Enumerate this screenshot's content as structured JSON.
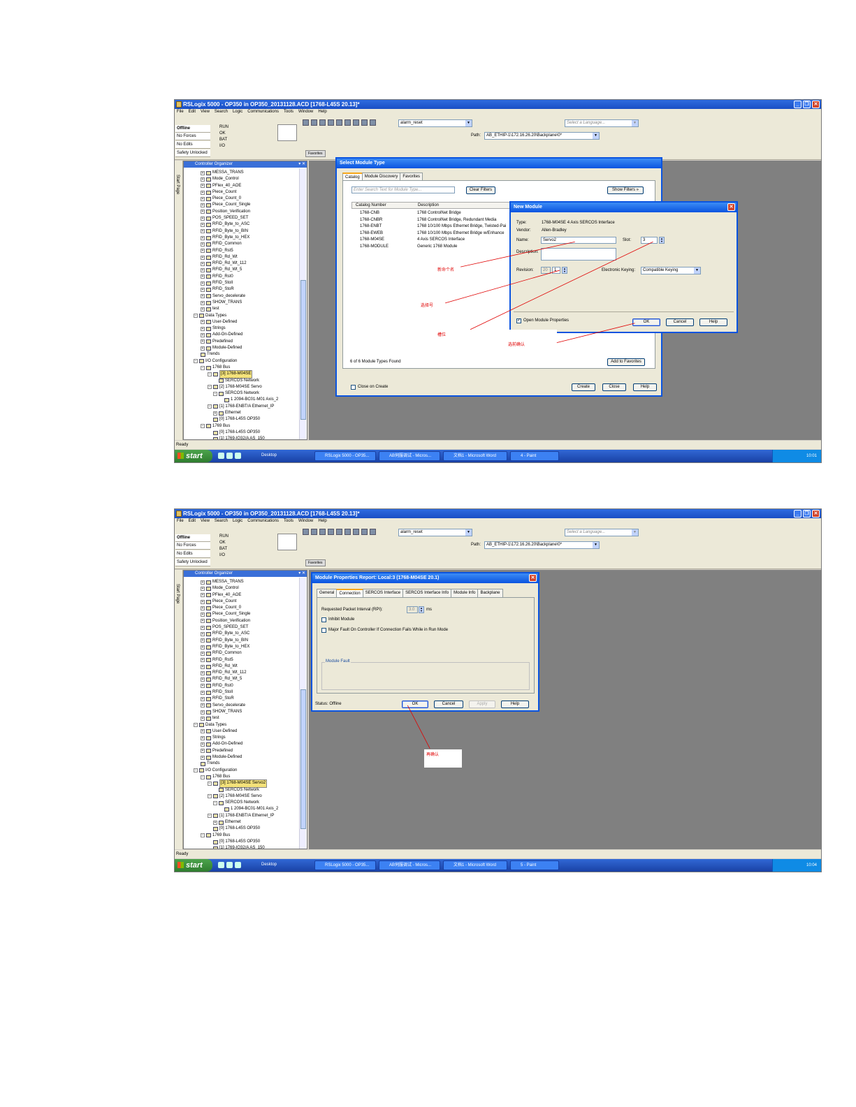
{
  "app": {
    "title": "RSLogix 5000 - OP350 in OP350_20131128.ACD [1768-L45S 20.13]*",
    "menu": [
      "File",
      "Edit",
      "View",
      "Search",
      "Logic",
      "Communications",
      "Tools",
      "Window",
      "Help"
    ],
    "status": {
      "offline": "Offline",
      "forces": "No Forces",
      "edits": "No Edits",
      "safety": "Safety Unlocked"
    },
    "indicators": [
      "RUN",
      "OK",
      "BAT",
      "I/O"
    ],
    "routine_combo": "alarm_reset",
    "language_combo_placeholder": "Select a Language...",
    "path_label": "Path:",
    "path_value": "AB_ETHIP-1\\172.16.26.20\\Backplane\\0*",
    "toolbar_tab": "Favorites",
    "organizer_title": "Controller Organizer",
    "start_page_tab": "Start Page",
    "status_line": "Ready"
  },
  "tree": {
    "programs": [
      "MESSA_TRANS",
      "Mode_Control",
      "PFlex_40_AOE",
      "Piece_Count",
      "Piece_Count_0",
      "Piece_Count_Single",
      "Position_Verification",
      "POS_SPEED_SET",
      "RFID_Byte_to_ASC",
      "RFID_Byte_to_BIN",
      "RFID_Byte_to_HEX",
      "RFID_Common",
      "RFID_Rst5",
      "RFID_Rd_Wt",
      "RFID_Rd_Wt_112",
      "RFID_Rd_Wt_5",
      "RFID_Rst0",
      "RFID_Stoll",
      "RFID_StoR",
      "Servo_decelerate",
      "SHOW_TRANS",
      "test"
    ],
    "data_types_label": "Data Types",
    "data_types": [
      "User-Defined",
      "Strings",
      "Add-On-Defined",
      "Predefined",
      "Module-Defined"
    ],
    "trends_label": "Trends",
    "io_label": "I/O Configuration",
    "bus_1768": "1768 Bus",
    "module_new_a": "[3] 1768-M04SE",
    "module_new_b": "[3] 1768-M04SE Servo2",
    "sercos_1": "SERCOS Network",
    "module_servo": "[2] 1768-M04SE Servo",
    "sercos_2": "SERCOS Network",
    "axis": "1 2094-BC01-M01 Axis_2",
    "enbt": "[1] 1768-ENBT/A Ethernet_IP",
    "ethernet": "Ethernet",
    "l45s": "[0] 1768-L45S OP350",
    "bus_1769": "1769 Bus",
    "l45s_2": "[0] 1768-L45S OP350",
    "last_row": "[1] 1769-IQ32/A AS_150"
  },
  "taskbar": {
    "start": "start",
    "desktop": "Desktop",
    "tasks": [
      "RSLogix 5000 - OP35...",
      "AB伺服调试 - Micros...",
      "文档1 - Microsoft Word"
    ],
    "paint_1": "4 - Paint",
    "paint_2": "5 - Paint",
    "clock_1": "10:01",
    "clock_2": "10:04"
  },
  "select_module": {
    "title": "Select Module Type",
    "tabs": [
      "Catalog",
      "Module Discovery",
      "Favorites"
    ],
    "search_placeholder": "Enter Search Text for Module Type...",
    "clear_filters": "Clear Filters",
    "show_filters": "Show Filters »",
    "columns": [
      "Catalog Number",
      "Description"
    ],
    "rows": [
      [
        "1768-CNB",
        "1768 ControlNet Bridge"
      ],
      [
        "1768-CNBR",
        "1768 ControlNet Bridge, Redundant Media"
      ],
      [
        "1768-ENBT",
        "1768 10/100 Mbps Ethernet Bridge, Twisted-Pai"
      ],
      [
        "1768-EWEB",
        "1768 10/100 Mbps Ethernet Bridge w/Enhance"
      ],
      [
        "1768-M04SE",
        "4 Axis SERCOS Interface"
      ],
      [
        "1768-MODULE",
        "Generic 1768 Module"
      ]
    ],
    "found": "6 of 6 Module Types Found",
    "add_fav": "Add to Favorites",
    "close_on_create": "Close on Create",
    "create": "Create",
    "close": "Close",
    "help": "Help"
  },
  "new_module": {
    "title": "New Module",
    "type_label": "Type:",
    "type_value": "1768-M04SE 4 Axis SERCOS Interface",
    "vendor_label": "Vendor:",
    "vendor_value": "Allen-Bradley",
    "name_label": "Name:",
    "name_value": "Servo2",
    "slot_label": "Slot:",
    "slot_value": "3",
    "desc_label": "Description:",
    "revision_label": "Revision:",
    "rev_major": "20",
    "rev_minor": "1",
    "keying_label": "Electronic Keying:",
    "keying_value": "Compatible Keying",
    "open_props": "Open Module Properties",
    "ok": "OK",
    "cancel": "Cancel",
    "help": "Help"
  },
  "annotations_1": [
    "新命个名",
    "选择号",
    "槽位",
    "选前确认"
  ],
  "props": {
    "title": "Module Properties Report: Local:3 (1768-M04SE 20.1)",
    "tabs": [
      "General",
      "Connection",
      "SERCOS Interface",
      "SERCOS Interface Info",
      "Module Info",
      "Backplane"
    ],
    "rpi_label": "Requested Packet Interval (RPI):",
    "rpi_value": "3.0",
    "rpi_unit": "ms",
    "inhibit": "Inhibit Module",
    "major_fault": "Major Fault On Controller If Connection Fails While in Run Mode",
    "module_fault": "Module Fault",
    "status": "Status:  Offline",
    "ok": "OK",
    "cancel": "Cancel",
    "apply": "Apply",
    "help": "Help"
  },
  "annotations_2": [
    "再确认"
  ]
}
